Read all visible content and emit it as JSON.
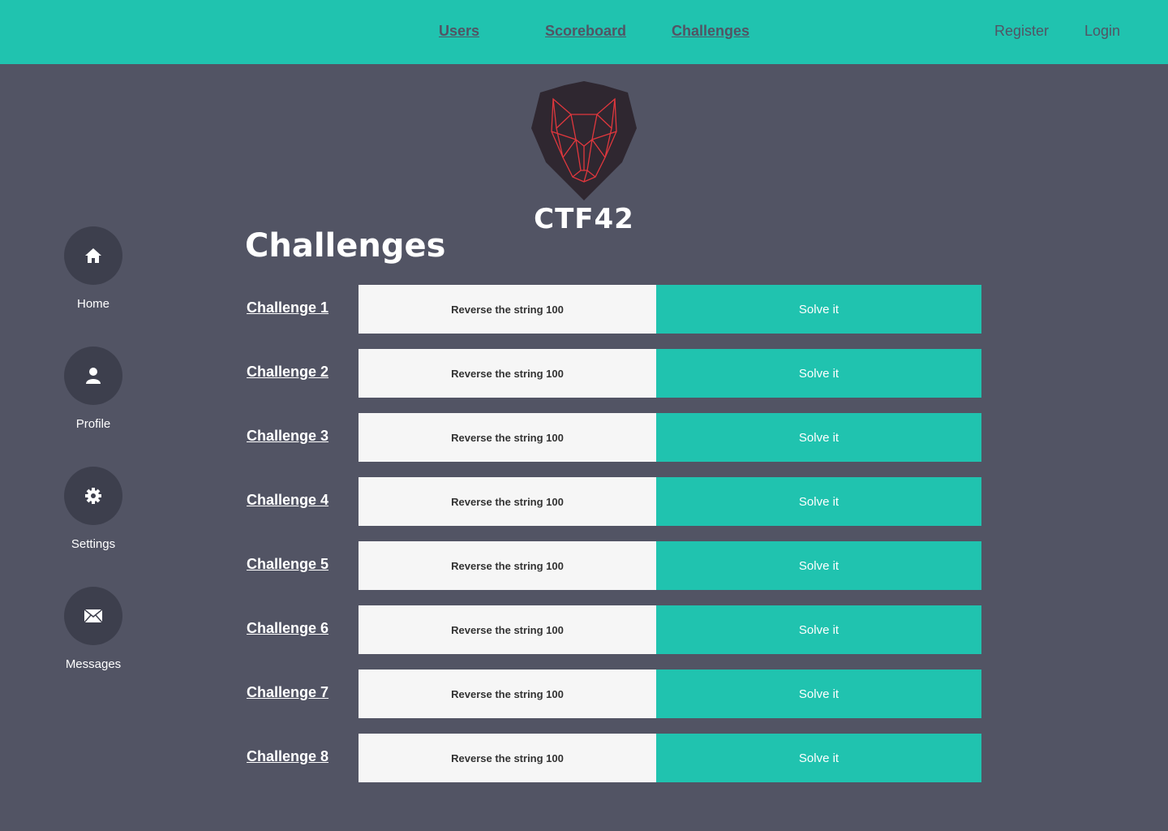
{
  "nav": {
    "users": "Users",
    "scoreboard": "Scoreboard",
    "challenges": "Challenges",
    "register": "Register",
    "login": "Login"
  },
  "brand": "CTF42",
  "page_title": "Challenges",
  "sidebar": [
    {
      "label": "Home",
      "icon": "home-icon"
    },
    {
      "label": "Profile",
      "icon": "user-icon"
    },
    {
      "label": "Settings",
      "icon": "gear-icon"
    },
    {
      "label": "Messages",
      "icon": "mail-icon"
    }
  ],
  "challenges": [
    {
      "name": "Challenge 1",
      "desc": "Reverse the string 100",
      "action": "Solve it"
    },
    {
      "name": "Challenge 2",
      "desc": "Reverse the string 100",
      "action": "Solve it"
    },
    {
      "name": "Challenge 3",
      "desc": "Reverse the string 100",
      "action": "Solve it"
    },
    {
      "name": "Challenge 4",
      "desc": "Reverse the string 100",
      "action": "Solve it"
    },
    {
      "name": "Challenge 5",
      "desc": "Reverse the string 100",
      "action": "Solve it"
    },
    {
      "name": "Challenge 6",
      "desc": "Reverse the string 100",
      "action": "Solve it"
    },
    {
      "name": "Challenge 7",
      "desc": "Reverse the string 100",
      "action": "Solve it"
    },
    {
      "name": "Challenge 8",
      "desc": "Reverse the string 100",
      "action": "Solve it"
    }
  ]
}
